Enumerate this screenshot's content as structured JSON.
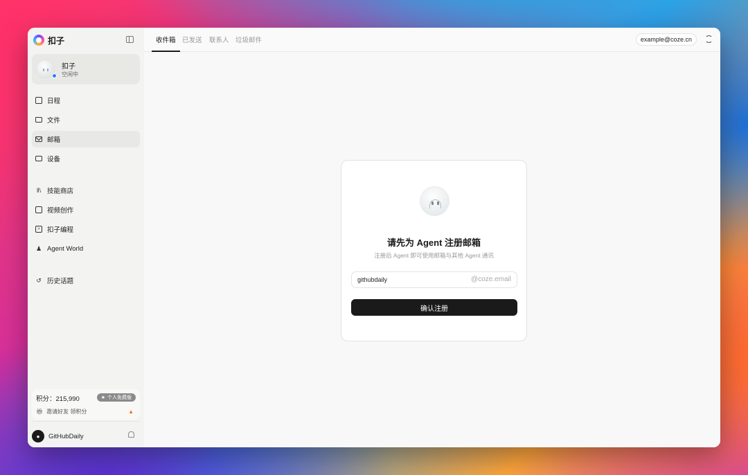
{
  "app": {
    "name": "扣子"
  },
  "agent": {
    "name": "扣子",
    "status": "空闲中"
  },
  "sidebar": {
    "items": [
      {
        "label": "日程",
        "icon": "calendar-icon"
      },
      {
        "label": "文件",
        "icon": "folder-icon"
      },
      {
        "label": "邮箱",
        "icon": "mail-icon",
        "active": true
      },
      {
        "label": "设备",
        "icon": "device-icon"
      },
      {
        "label": "技能商店",
        "icon": "library-icon"
      },
      {
        "label": "视频创作",
        "icon": "clapperboard-icon"
      },
      {
        "label": "扣子编程",
        "icon": "terminal-icon"
      },
      {
        "label": "Agent World",
        "icon": "user-stack-icon"
      },
      {
        "label": "历史话题",
        "icon": "history-icon"
      }
    ]
  },
  "points": {
    "label": "积分：215,990",
    "plan": "个人免费版",
    "invite": "邀请好友 领积分"
  },
  "user": {
    "name": "GitHubDaily"
  },
  "tabs": [
    "收件箱",
    "已发送",
    "联系人",
    "垃圾邮件"
  ],
  "header": {
    "email": "example@coze.cn"
  },
  "register": {
    "title": "请先为 Agent 注册邮箱",
    "subtitle": "注册后 Agent 即可使用邮箱与其他 Agent 通讯",
    "input_value": "githubdaily",
    "domain_suffix": "@coze.email",
    "confirm_label": "确认注册"
  },
  "colors": {
    "accent": "#1a1a1a",
    "status_dot": "#2f7dff",
    "badge": "#8a8a8a"
  }
}
